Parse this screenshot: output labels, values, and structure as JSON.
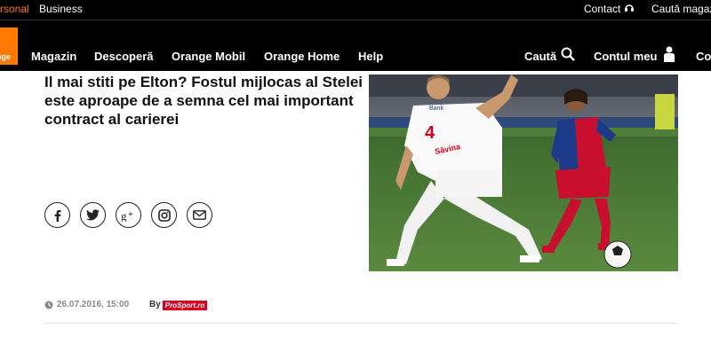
{
  "topbar": {
    "personal": "rsonal",
    "business": "Business",
    "contact": "Contact",
    "cauta_magazin": "Caută magazi"
  },
  "logo": {
    "text": "nge"
  },
  "nav": {
    "items": [
      "Magazin",
      "Descoperă",
      "Orange Mobil",
      "Orange Home",
      "Help"
    ],
    "search": "Caută",
    "account": "Contul meu",
    "extra": "Co"
  },
  "article": {
    "title": "Il mai stiti pe Elton? Fostul mijlocas al Stelei este aproape de a semna cel mai important contract al carierei",
    "date": "26.07.2016, 15:00",
    "by": "By",
    "source": "ProSport.ro"
  },
  "photo": {
    "jersey_text": "Bank",
    "player_name": "Săvina",
    "player_number": "4"
  },
  "social": [
    "facebook-icon",
    "twitter-icon",
    "google-plus-icon",
    "instagram-icon",
    "email-icon"
  ],
  "colors": {
    "brand": "#ff7900",
    "source": "#d6001c"
  }
}
